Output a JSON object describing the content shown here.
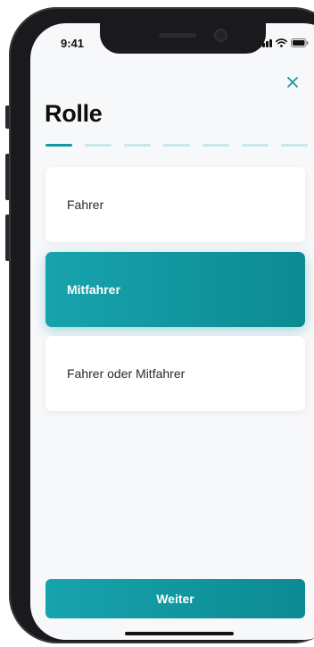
{
  "status_bar": {
    "time": "9:41",
    "icons": [
      "cellular-signal-icon",
      "wifi-icon",
      "battery-icon"
    ]
  },
  "header": {
    "close_icon": "close-icon",
    "title": "Rolle"
  },
  "progress": {
    "total_steps": 7,
    "current_step": 1
  },
  "options": [
    {
      "label": "Fahrer",
      "selected": false
    },
    {
      "label": "Mitfahrer",
      "selected": true
    },
    {
      "label": "Fahrer oder Mitfahrer",
      "selected": false
    }
  ],
  "footer": {
    "next_label": "Weiter"
  },
  "colors": {
    "accent": "#1498a2",
    "accent_light": "#c7e7ea",
    "background": "#f7f8fa",
    "card": "#ffffff"
  }
}
